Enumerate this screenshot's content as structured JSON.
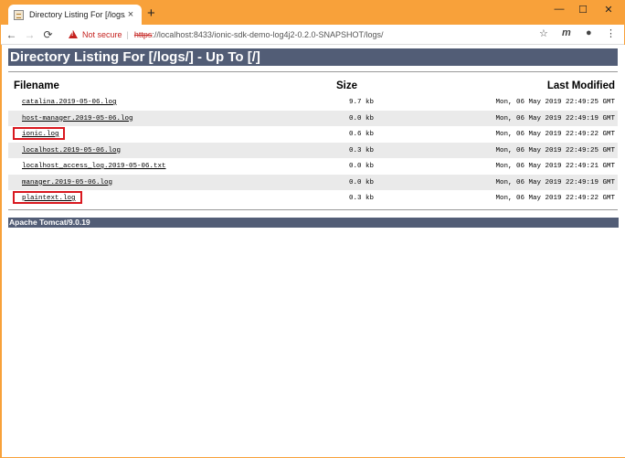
{
  "browser": {
    "tab_title": "Directory Listing For [/logs/]",
    "tab_close": "×",
    "new_tab": "+",
    "window_controls": {
      "minimize": "—",
      "maximize": "☐",
      "close": "✕"
    },
    "nav": {
      "back": "←",
      "forward": "→",
      "reload": "⟳"
    },
    "security_label": "Not secure",
    "url_scheme": "https",
    "url_rest": "://localhost:8433/ionic-sdk-demo-log4j2-0.2.0-SNAPSHOT/logs/",
    "toolbar_icons": {
      "star": "☆",
      "extension": "m",
      "account": "●",
      "menu": "⋮"
    }
  },
  "page": {
    "heading": "Directory Listing For [/logs/] - Up To [/]",
    "columns": {
      "filename": "Filename",
      "size": "Size",
      "modified": "Last Modified"
    },
    "files": [
      {
        "name": "catalina.2019-05-06.log",
        "size": "9.7 kb",
        "modified": "Mon, 06 May 2019 22:49:25 GMT",
        "highlighted": false
      },
      {
        "name": "host-manager.2019-05-06.log",
        "size": "0.0 kb",
        "modified": "Mon, 06 May 2019 22:49:19 GMT",
        "highlighted": false
      },
      {
        "name": "ionic.log",
        "size": "0.6 kb",
        "modified": "Mon, 06 May 2019 22:49:22 GMT",
        "highlighted": true
      },
      {
        "name": "localhost.2019-05-06.log",
        "size": "0.3 kb",
        "modified": "Mon, 06 May 2019 22:49:25 GMT",
        "highlighted": false
      },
      {
        "name": "localhost_access_log.2019-05-06.txt",
        "size": "0.0 kb",
        "modified": "Mon, 06 May 2019 22:49:21 GMT",
        "highlighted": false
      },
      {
        "name": "manager.2019-05-06.log",
        "size": "0.0 kb",
        "modified": "Mon, 06 May 2019 22:49:19 GMT",
        "highlighted": false
      },
      {
        "name": "plaintext.log",
        "size": "0.3 kb",
        "modified": "Mon, 06 May 2019 22:49:22 GMT",
        "highlighted": true
      }
    ],
    "footer": "Apache Tomcat/9.0.19"
  },
  "colors": {
    "window_frame": "#f8a13a",
    "heading_bar": "#525d76",
    "highlight_box": "#d9181f",
    "row_shade": "#eaeaea"
  }
}
